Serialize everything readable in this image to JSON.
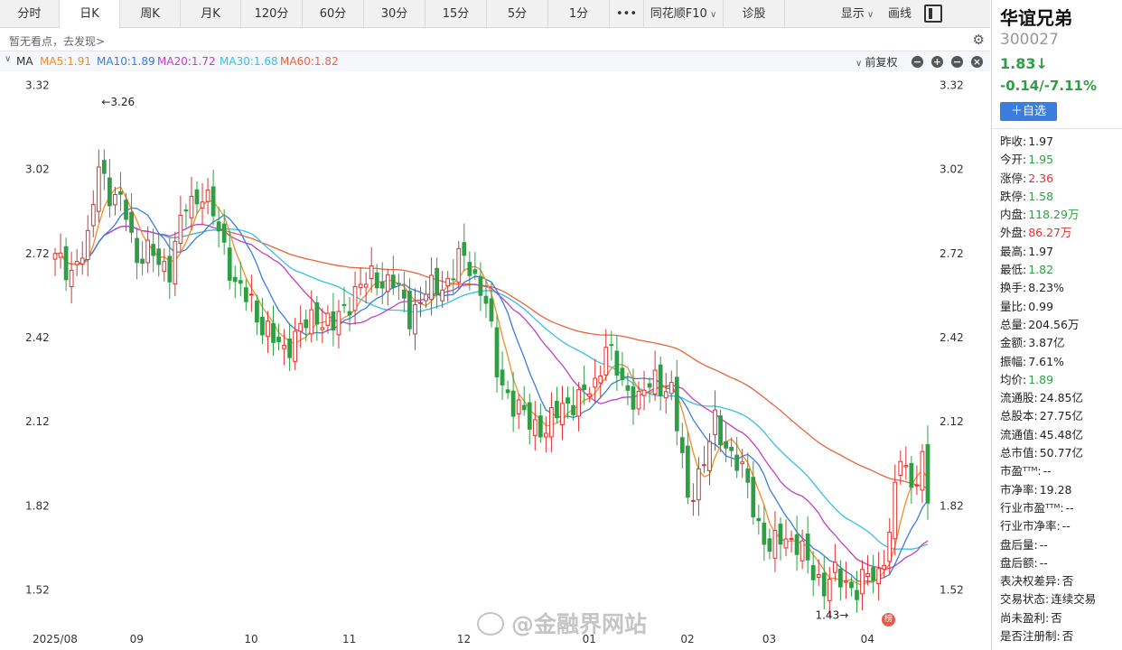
{
  "toolbar": {
    "tabs": [
      {
        "label": "分时",
        "active": false
      },
      {
        "label": "日K",
        "active": true
      },
      {
        "label": "周K",
        "active": false
      },
      {
        "label": "月K",
        "active": false
      },
      {
        "label": "120分",
        "active": false
      },
      {
        "label": "60分",
        "active": false
      },
      {
        "label": "30分",
        "active": false
      },
      {
        "label": "15分",
        "active": false
      },
      {
        "label": "5分",
        "active": false
      },
      {
        "label": "1分",
        "active": false
      }
    ],
    "more": "•••",
    "f10": "同花顺F10",
    "diagnose": "诊股",
    "display": "显示",
    "draw": "画线"
  },
  "notice": "暂无看点，去发现>",
  "indicator": {
    "name": "MA",
    "mas": [
      {
        "label": "MA5:1.91",
        "color": "#f28c28"
      },
      {
        "label": "MA10:1.89",
        "color": "#3b7ddd"
      },
      {
        "label": "MA20:1.72",
        "color": "#c23fc2"
      },
      {
        "label": "MA30:1.68",
        "color": "#35c2e0"
      },
      {
        "label": "MA60:1.82",
        "color": "#e8643c"
      }
    ],
    "adjust": "前复权"
  },
  "stock": {
    "name": "华谊兄弟",
    "code": "300027",
    "price": "1.83↓",
    "change": "-0.14/-7.11%",
    "add_watch": "＋自选"
  },
  "stats": [
    {
      "label": "昨收:",
      "value": "1.97",
      "tone": "plain"
    },
    {
      "label": "今开:",
      "value": "1.95",
      "tone": "green"
    },
    {
      "label": "涨停:",
      "value": "2.36",
      "tone": "red"
    },
    {
      "label": "跌停:",
      "value": "1.58",
      "tone": "green"
    },
    {
      "label": "内盘:",
      "value": "118.29万",
      "tone": "green"
    },
    {
      "label": "外盘:",
      "value": "86.27万",
      "tone": "red"
    },
    {
      "label": "最高:",
      "value": "1.97",
      "tone": "plain"
    },
    {
      "label": "最低:",
      "value": "1.82",
      "tone": "green"
    },
    {
      "label": "换手:",
      "value": "8.23%",
      "tone": "plain"
    },
    {
      "label": "量比:",
      "value": "0.99",
      "tone": "plain"
    },
    {
      "label": "总量:",
      "value": "204.56万",
      "tone": "plain"
    },
    {
      "label": "金额:",
      "value": "3.87亿",
      "tone": "plain"
    },
    {
      "label": "振幅:",
      "value": "7.61%",
      "tone": "plain"
    },
    {
      "label": "均价:",
      "value": "1.89",
      "tone": "green"
    },
    {
      "label": "流通股:",
      "value": "24.85亿",
      "tone": "plain"
    },
    {
      "label": "总股本:",
      "value": "27.75亿",
      "tone": "plain"
    },
    {
      "label": "流通值:",
      "value": "45.48亿",
      "tone": "plain"
    },
    {
      "label": "总市值:",
      "value": "50.77亿",
      "tone": "plain"
    },
    {
      "label": "市盈ᵀᵀᴹ:",
      "value": "--",
      "tone": "plain"
    },
    {
      "label": "市净率:",
      "value": "19.28",
      "tone": "plain"
    },
    {
      "label": "行业市盈ᵀᵀᴹ:",
      "value": "--",
      "tone": "plain"
    },
    {
      "label": "行业市净率:",
      "value": "--",
      "tone": "plain"
    },
    {
      "label": "盘后量:",
      "value": "--",
      "tone": "plain"
    },
    {
      "label": "盘后额:",
      "value": "--",
      "tone": "plain"
    },
    {
      "label": "表决权差异:",
      "value": "否",
      "tone": "plain"
    },
    {
      "label": "交易状态:",
      "value": "连续交易",
      "tone": "plain"
    },
    {
      "label": "尚未盈利:",
      "value": "否",
      "tone": "plain"
    },
    {
      "label": "是否注册制:",
      "value": "否",
      "tone": "plain"
    }
  ],
  "watermark": "@金融界网站",
  "seal_text": "榜",
  "chart_data": {
    "type": "candlestick",
    "y_ticks": [
      "3.32",
      "3.02",
      "2.72",
      "2.42",
      "2.12",
      "1.82",
      "1.52"
    ],
    "ylim": [
      1.38,
      3.37
    ],
    "x_labels": [
      {
        "label": "2025/08",
        "index": 0
      },
      {
        "label": "09",
        "index": 15
      },
      {
        "label": "10",
        "index": 36
      },
      {
        "label": "11",
        "index": 54
      },
      {
        "label": "12",
        "index": 75
      },
      {
        "label": "01",
        "index": 98
      },
      {
        "label": "02",
        "index": 116
      },
      {
        "label": "03",
        "index": 131
      },
      {
        "label": "04",
        "index": 149
      }
    ],
    "annotations": [
      {
        "text": "←3.26",
        "index": 8,
        "value": 3.26
      },
      {
        "text": "1.43→",
        "index": 147,
        "value": 1.43
      }
    ],
    "ma_colors": {
      "ma5": "#f28c28",
      "ma10": "#3b7ddd",
      "ma20": "#c23fc2",
      "ma30": "#35c2e0",
      "ma60": "#e8643c"
    },
    "up_color": "#e03131",
    "down_color": "#2f9e44",
    "close_path": [
      [
        0,
        2.7
      ],
      [
        3,
        2.66
      ],
      [
        6,
        2.75
      ],
      [
        8,
        3.06
      ],
      [
        10,
        2.92
      ],
      [
        13,
        2.88
      ],
      [
        15,
        2.7
      ],
      [
        18,
        2.72
      ],
      [
        21,
        2.66
      ],
      [
        24,
        2.9
      ],
      [
        27,
        2.93
      ],
      [
        29,
        2.86
      ],
      [
        31,
        2.75
      ],
      [
        33,
        2.6
      ],
      [
        36,
        2.55
      ],
      [
        38,
        2.46
      ],
      [
        40,
        2.41
      ],
      [
        42,
        2.38
      ],
      [
        45,
        2.45
      ],
      [
        48,
        2.5
      ],
      [
        51,
        2.46
      ],
      [
        53,
        2.52
      ],
      [
        55,
        2.59
      ],
      [
        58,
        2.63
      ],
      [
        62,
        2.62
      ],
      [
        65,
        2.5
      ],
      [
        68,
        2.58
      ],
      [
        72,
        2.62
      ],
      [
        74,
        2.7
      ],
      [
        76,
        2.68
      ],
      [
        79,
        2.55
      ],
      [
        81,
        2.3
      ],
      [
        84,
        2.18
      ],
      [
        87,
        2.12
      ],
      [
        90,
        2.09
      ],
      [
        93,
        2.18
      ],
      [
        96,
        2.2
      ],
      [
        99,
        2.25
      ],
      [
        101,
        2.4
      ],
      [
        104,
        2.25
      ],
      [
        107,
        2.2
      ],
      [
        110,
        2.27
      ],
      [
        113,
        2.23
      ],
      [
        116,
        1.85
      ],
      [
        119,
        1.97
      ],
      [
        121,
        2.12
      ],
      [
        124,
        2.0
      ],
      [
        127,
        1.9
      ],
      [
        129,
        1.75
      ],
      [
        131,
        1.65
      ],
      [
        133,
        1.72
      ],
      [
        135,
        1.7
      ],
      [
        138,
        1.62
      ],
      [
        141,
        1.53
      ],
      [
        143,
        1.57
      ],
      [
        145,
        1.55
      ],
      [
        147,
        1.52
      ],
      [
        149,
        1.57
      ],
      [
        151,
        1.58
      ],
      [
        153,
        1.72
      ],
      [
        155,
        2.0
      ],
      [
        157,
        1.9
      ],
      [
        159,
        1.97
      ],
      [
        160,
        1.83
      ]
    ],
    "count": 161
  }
}
